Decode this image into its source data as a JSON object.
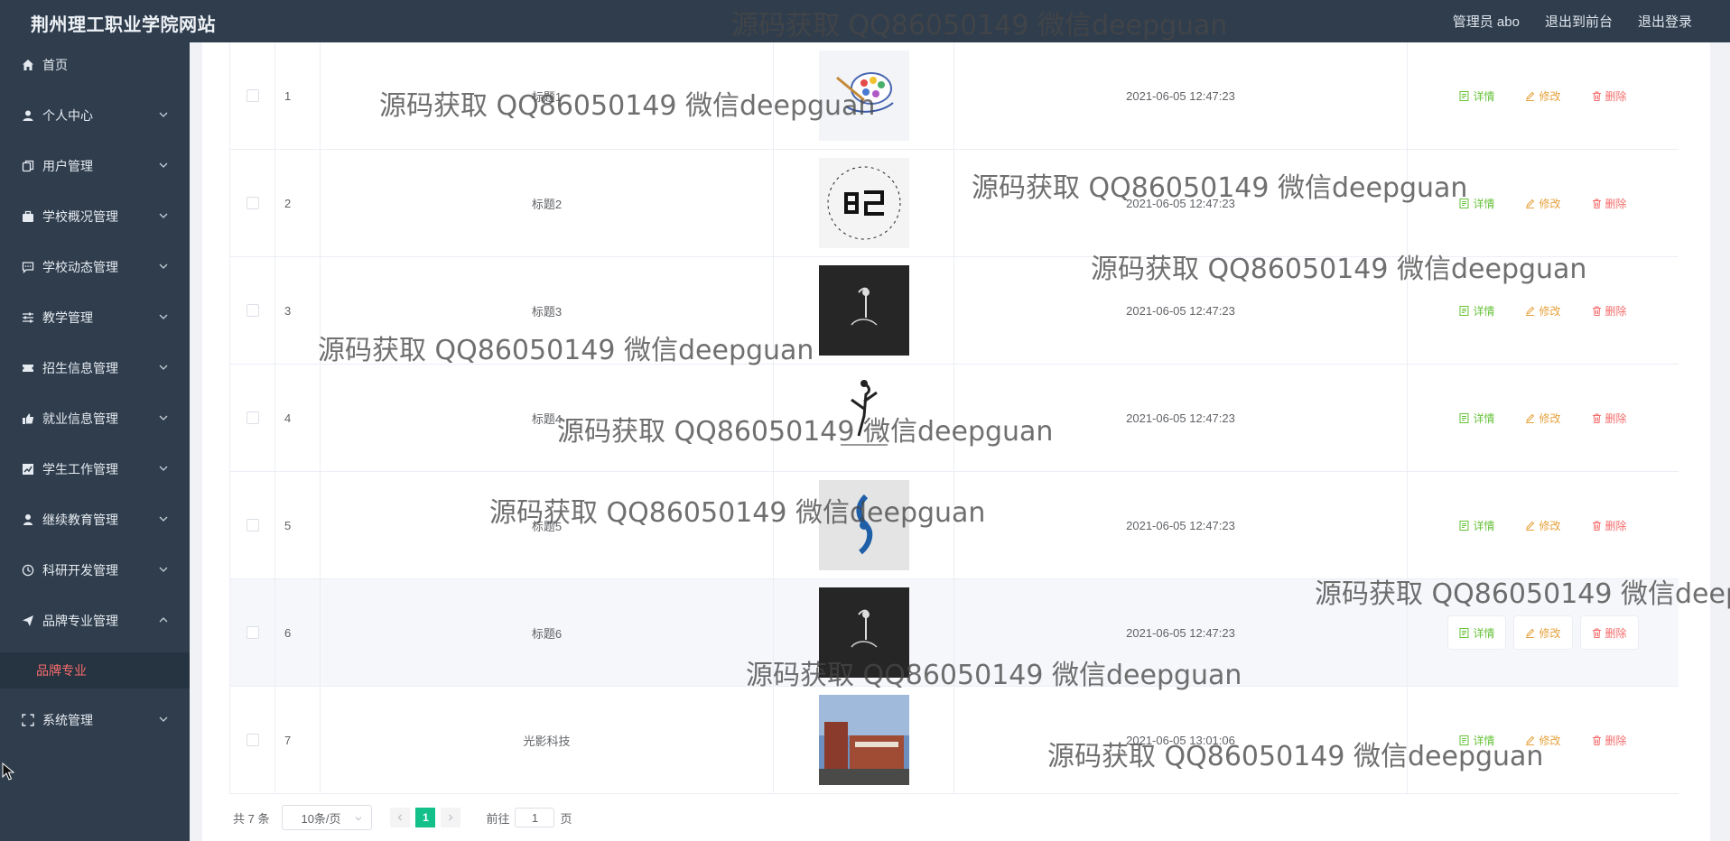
{
  "header": {
    "site_title": "荆州理工职业学院网站",
    "user_label": "管理员 abo",
    "front_link": "退出到前台",
    "logout_link": "退出登录"
  },
  "sidebar": {
    "items": [
      {
        "label": "首页",
        "icon": "home-icon"
      },
      {
        "label": "个人中心",
        "icon": "user-icon"
      },
      {
        "label": "用户管理",
        "icon": "copy-icon"
      },
      {
        "label": "学校概况管理",
        "icon": "briefcase-icon"
      },
      {
        "label": "学校动态管理",
        "icon": "chat-icon"
      },
      {
        "label": "教学管理",
        "icon": "sliders-icon"
      },
      {
        "label": "招生信息管理",
        "icon": "ticket-icon"
      },
      {
        "label": "就业信息管理",
        "icon": "thumb-up-icon"
      },
      {
        "label": "学生工作管理",
        "icon": "chart-icon"
      },
      {
        "label": "继续教育管理",
        "icon": "person-icon"
      },
      {
        "label": "科研开发管理",
        "icon": "clock-icon"
      },
      {
        "label": "品牌专业管理",
        "icon": "send-icon"
      },
      {
        "label": "系统管理",
        "icon": "fullscreen-icon"
      }
    ],
    "active_sub": "品牌专业"
  },
  "table": {
    "rows": [
      {
        "index": "1",
        "title": "标题1",
        "time": "2021-06-05 12:47:23"
      },
      {
        "index": "2",
        "title": "标题2",
        "time": "2021-06-05 12:47:23"
      },
      {
        "index": "3",
        "title": "标题3",
        "time": "2021-06-05 12:47:23"
      },
      {
        "index": "4",
        "title": "标题4",
        "time": "2021-06-05 12:47:23"
      },
      {
        "index": "5",
        "title": "标题5",
        "time": "2021-06-05 12:47:23"
      },
      {
        "index": "6",
        "title": "标题6",
        "time": "2021-06-05 12:47:23"
      },
      {
        "index": "7",
        "title": "光影科技",
        "time": "2021-06-05 13:01:06"
      }
    ],
    "actions": {
      "detail": "详情",
      "edit": "修改",
      "delete": "删除"
    }
  },
  "pagination": {
    "total": "共 7 条",
    "page_size": "10条/页",
    "current_page": "1",
    "goto_prefix": "前往",
    "goto_value": "1",
    "goto_suffix": "页"
  },
  "watermark": {
    "text": "源码获取 QQ86050149 微信deepguan"
  },
  "colors": {
    "sidebar_bg": "#2f3d4d",
    "active_menu": "#f56c6c",
    "pager_active": "#13c08a",
    "detail": "#67c23a",
    "edit": "#e6a23c",
    "delete": "#f56c6c"
  }
}
